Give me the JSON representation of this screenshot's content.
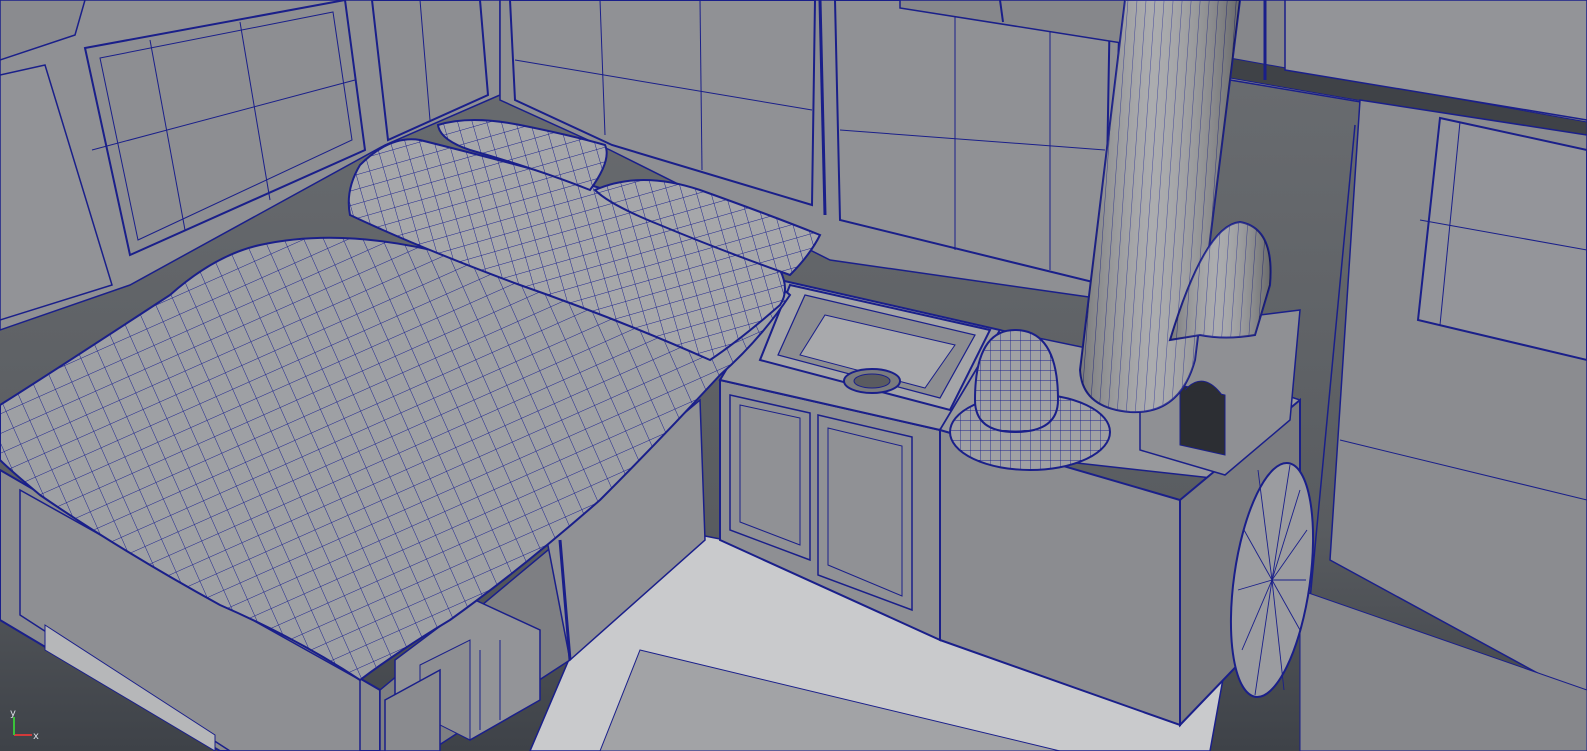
{
  "viewport": {
    "mode": "wireframe-on-shaded",
    "wire_color": "#1a1f8a",
    "surface_color": "#9a9b9e",
    "floor_color": "#c8c9cb",
    "background_color": "#5f6266"
  },
  "axis_gizmo": {
    "x_label": "x",
    "y_label": "y",
    "x_color": "#d23a3a",
    "y_color": "#3ac23a"
  }
}
